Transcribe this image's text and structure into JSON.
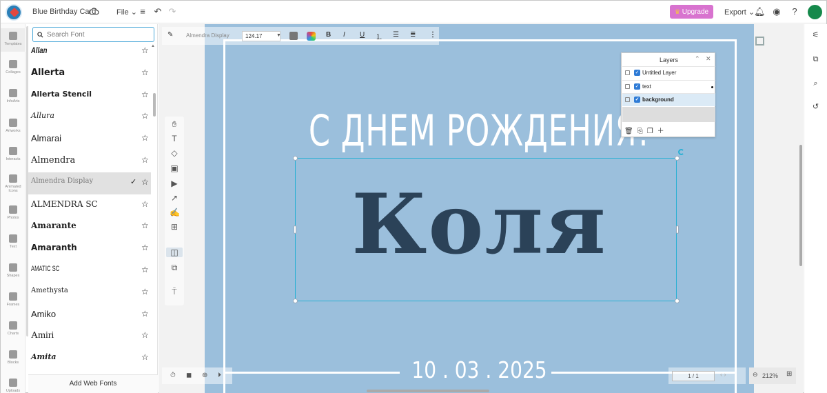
{
  "app": {
    "doc_title": "Blue Birthday Card",
    "menu_file": "File ⌄",
    "upgrade_label": "Upgrade",
    "export_label": "Export ⌄",
    "accent_color": "#d873cf",
    "avatar_color": "#15894b"
  },
  "rail": {
    "items": [
      {
        "label": "Templates",
        "icon": "templates-icon"
      },
      {
        "label": "Collages",
        "icon": "collages-icon"
      },
      {
        "label": "InfoArts",
        "icon": "infoarts-icon"
      },
      {
        "label": "Artworks",
        "icon": "artworks-icon"
      },
      {
        "label": "Interacts",
        "icon": "interacts-icon"
      },
      {
        "label": "Animated Icons",
        "icon": "animated-icons-icon"
      },
      {
        "label": "Photos",
        "icon": "photos-icon"
      },
      {
        "label": "Text",
        "icon": "text-icon"
      },
      {
        "label": "Shapes",
        "icon": "shapes-icon"
      },
      {
        "label": "Frames",
        "icon": "frames-icon"
      },
      {
        "label": "Charts",
        "icon": "charts-icon"
      },
      {
        "label": "Blocks",
        "icon": "blocks-icon"
      },
      {
        "label": "Uploads",
        "icon": "uploads-icon"
      }
    ]
  },
  "font_panel": {
    "search_placeholder": "Search Font",
    "fonts": [
      {
        "name": "Allan"
      },
      {
        "name": "Allerta"
      },
      {
        "name": "Allerta Stencil"
      },
      {
        "name": "Allura"
      },
      {
        "name": "Almarai"
      },
      {
        "name": "Almendra"
      },
      {
        "name": "Almendra Display",
        "selected": true
      },
      {
        "name": "ALMENDRA SC"
      },
      {
        "name": "Amarante"
      },
      {
        "name": "Amaranth"
      },
      {
        "name": "AMATIC SC"
      },
      {
        "name": "Amethysta"
      },
      {
        "name": "Amiko"
      },
      {
        "name": "Amiri"
      },
      {
        "name": "Amita"
      }
    ],
    "add_web_fonts": "Add Web Fonts"
  },
  "editor": {
    "current_font": "Almendra Display",
    "font_size": "124.17"
  },
  "canvas": {
    "background_color": "#9bbfdc",
    "heading": "С ДНЕМ РОЖДЕНИЯ!",
    "name": "Коля",
    "date": "10 . 03 . 2025",
    "name_color": "#2b4258"
  },
  "layers": {
    "title": "Layers",
    "rows": [
      {
        "name": "Untitled Layer",
        "active": false
      },
      {
        "name": "text",
        "active": false
      },
      {
        "name": "background",
        "active": true
      }
    ]
  },
  "pager": {
    "page": "1 / 1"
  },
  "zoom": {
    "value": "212%"
  }
}
